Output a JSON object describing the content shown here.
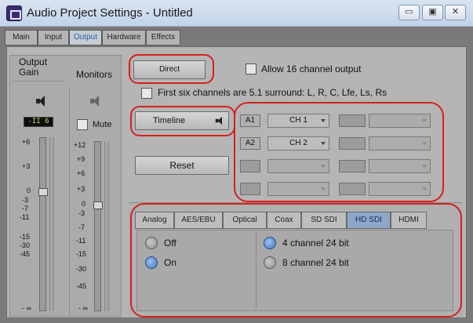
{
  "window": {
    "title": "Audio Project Settings - Untitled",
    "minimize_glyph": "▭",
    "maximize_glyph": "▣",
    "close_glyph": "✕"
  },
  "tabs": [
    {
      "label": "Main",
      "active": false
    },
    {
      "label": "Input",
      "active": false
    },
    {
      "label": "Output",
      "active": true
    },
    {
      "label": "Hardware",
      "active": false
    },
    {
      "label": "Effects",
      "active": false
    }
  ],
  "output": {
    "gain_label": "Output\nGain",
    "monitors_label": "Monitors",
    "gain_readout": "-II 6",
    "mute_label": "Mute",
    "gain_scale": [
      "+6",
      "+3",
      "0",
      "-3",
      "-7",
      "-11",
      "-15",
      "-30",
      "-45",
      "- ∞"
    ],
    "monitor_scale": [
      "+12",
      "+9",
      "+6",
      "+3",
      "0",
      "-3",
      "-7",
      "-11",
      "-15",
      "-30",
      "-45",
      "- ∞"
    ]
  },
  "routing": {
    "direct_button": "Direct",
    "allow16_label": "Allow 16 channel output",
    "surround_label": "First six channels are 5.1 surround: L, R, C, Lfe, Ls, Rs",
    "timeline_button": "Timeline",
    "reset_button": "Reset",
    "rows": [
      {
        "label": "A1",
        "value": "CH 1"
      },
      {
        "label": "A2",
        "value": "CH 2"
      },
      {
        "label": "",
        "value": ""
      },
      {
        "label": "",
        "value": ""
      }
    ]
  },
  "hardware_tabs": [
    {
      "label": "Analog",
      "active": false
    },
    {
      "label": "AES/EBU",
      "active": false
    },
    {
      "label": "Optical",
      "active": false
    },
    {
      "label": "Coax",
      "active": false
    },
    {
      "label": "SD SDI",
      "active": false
    },
    {
      "label": "HD SDI",
      "active": true
    },
    {
      "label": "HDMI",
      "active": false
    }
  ],
  "hd_sdi": {
    "off_label": "Off",
    "on_label": "On",
    "opt4_label": "4 channel 24 bit",
    "opt8_label": "8 channel 24 bit",
    "power": "On",
    "channels": "4 channel 24 bit"
  },
  "colors": {
    "annotation_red": "#d3221d",
    "active_tab_text": "#2d5fa8",
    "meter_text": "#b9e05a"
  }
}
